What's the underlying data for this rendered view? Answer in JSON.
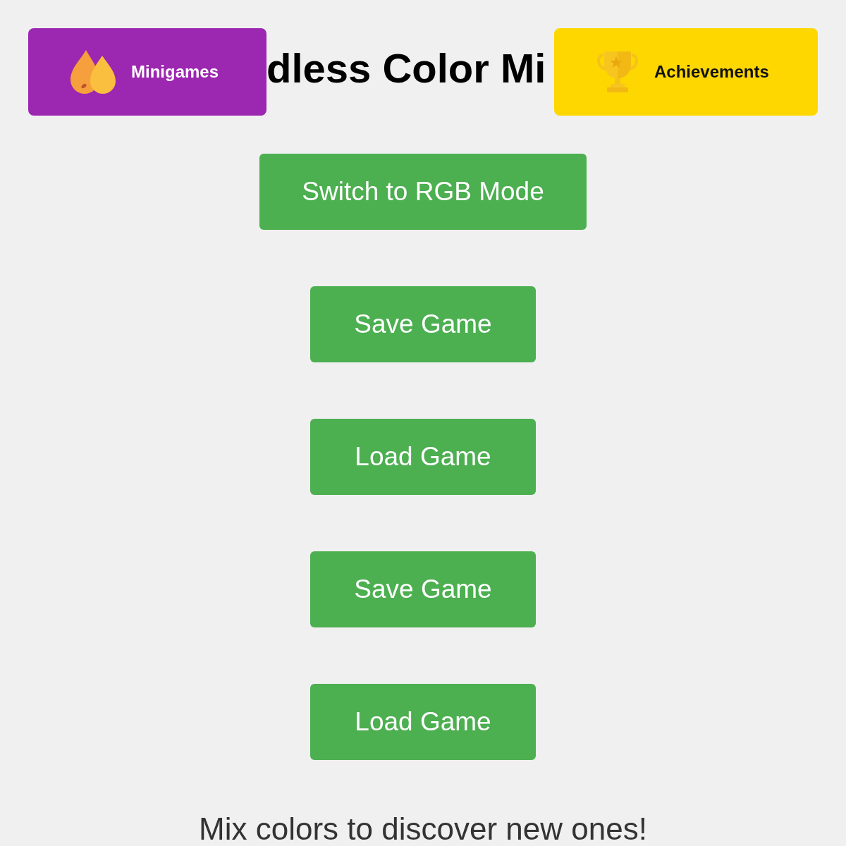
{
  "minigames_button": {
    "label": "Minigames"
  },
  "title": "dless Color Mi",
  "achievements_button": {
    "label": "Achievements"
  },
  "actions": [
    "Switch to RGB Mode",
    "Save Game",
    "Load Game",
    "Save Game",
    "Load Game"
  ],
  "tagline": "Mix colors to discover new ones!"
}
